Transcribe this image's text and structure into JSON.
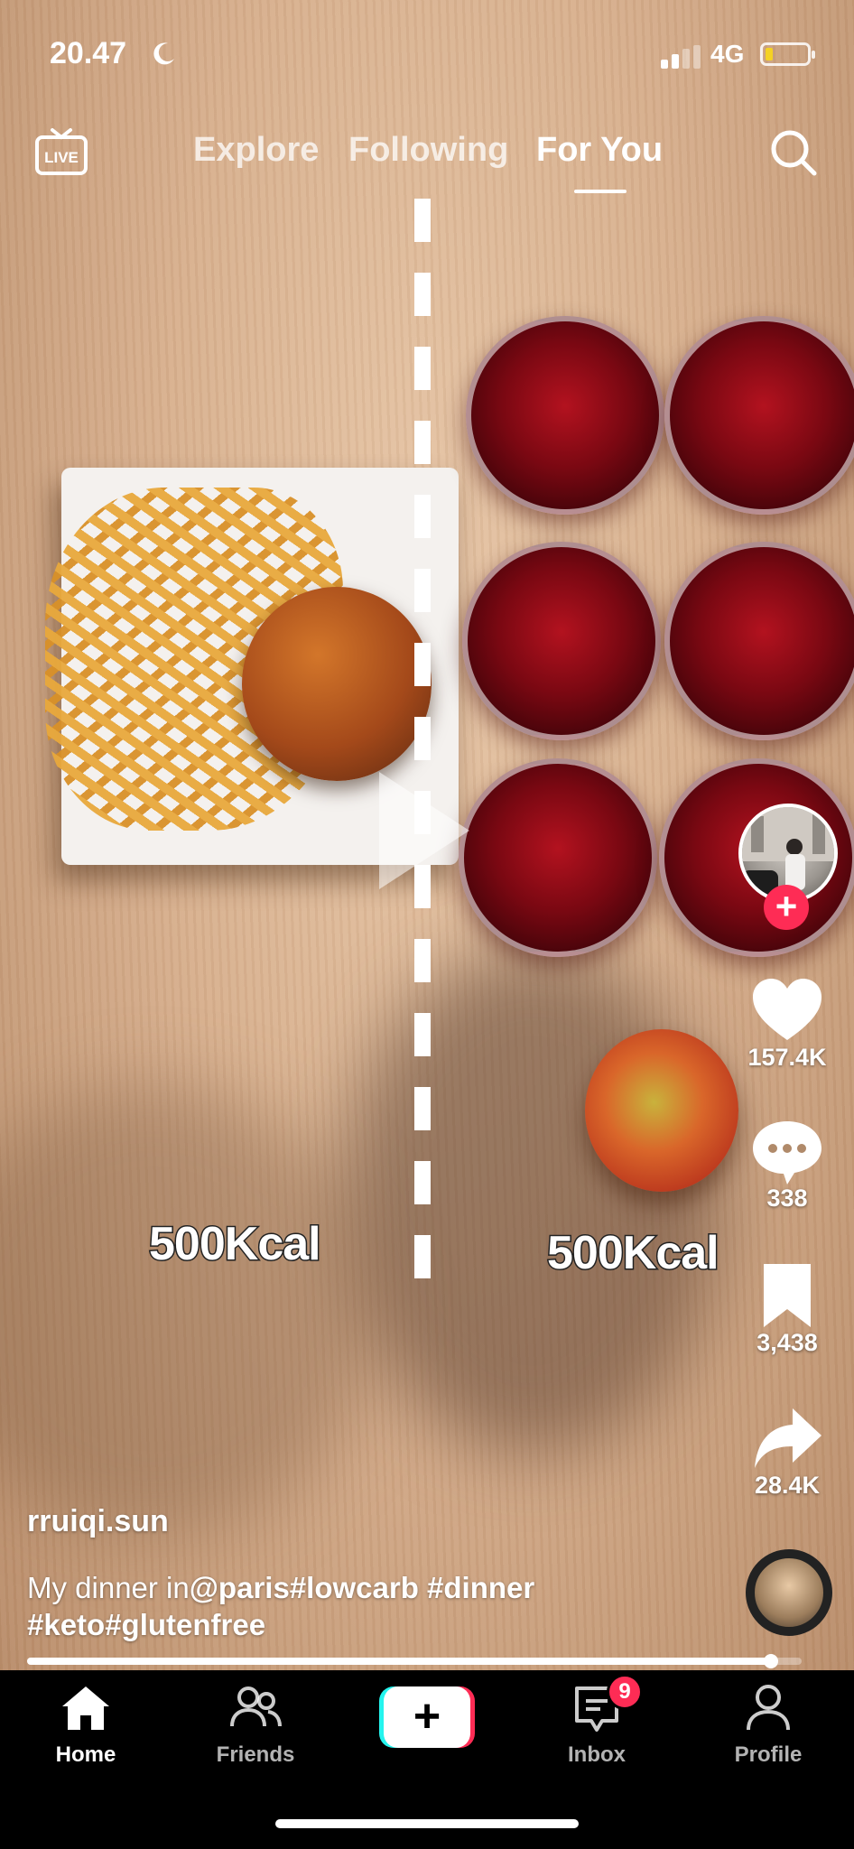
{
  "status_bar": {
    "time": "20.47",
    "network": "4G"
  },
  "top_nav": {
    "live_label": "LIVE",
    "tabs": [
      {
        "label": "Explore"
      },
      {
        "label": "Following"
      },
      {
        "label": "For You",
        "active": true
      }
    ]
  },
  "video": {
    "overlay_left": "500Kcal",
    "overlay_right": "500Kcal"
  },
  "right_rail": {
    "likes": "157.4K",
    "comments": "338",
    "saves": "3,438",
    "shares": "28.4K"
  },
  "post": {
    "username": "rruiqi.sun",
    "caption_lead": "My dinner in",
    "caption_tags_line1": "@paris#lowcarb #dinner",
    "caption_tags_line2": "#keto#glutenfree"
  },
  "playback": {
    "progress": 0.96
  },
  "bottom_nav": {
    "items": [
      {
        "label": "Home",
        "active": true
      },
      {
        "label": "Friends"
      },
      {
        "label": "Inbox",
        "badge": "9"
      },
      {
        "label": "Profile"
      }
    ]
  },
  "colors": {
    "accent": "#fe2c55",
    "cyan": "#25f4ee"
  }
}
